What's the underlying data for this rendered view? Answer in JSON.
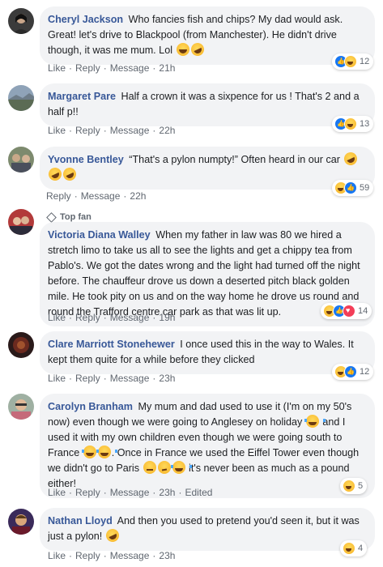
{
  "actions": {
    "like": "Like",
    "reply": "Reply",
    "message": "Message",
    "separator": "·",
    "edited": "Edited"
  },
  "comments": [
    {
      "author": "Cheryl Jackson",
      "text": "Who fancies fish and chips? My dad would ask. Great! let's drive to Blackpool (from Manchester). He didn't drive though, it was me mum. Lol",
      "time": "21h",
      "reaction_count": "12"
    },
    {
      "author": "Margaret Pare",
      "text": "Half a crown it was a sixpence for us ! That's 2 and a half p!!",
      "time": "22h",
      "reaction_count": "13"
    },
    {
      "author": "Yvonne Bentley",
      "text": "“That's a pylon numpty!” Often heard in our car",
      "time": "22h",
      "reaction_count": "59"
    },
    {
      "badge": "Top fan",
      "author": "Victoria Diana Walley",
      "text": "When my father in law was 80 we hired a stretch limo to take us all to see the lights and get a chippy tea from Pablo's. We got the dates wrong and the light had turned off the night before. The chauffeur drove us down a deserted pitch black golden mile. He took pity on us and on the way home he drove us round and round the Trafford centre car park as that was lit up.",
      "time": "19h",
      "reaction_count": "14"
    },
    {
      "author": "Clare Marriott Stonehewer",
      "text": "I once used this in the way to Wales. It kept them quite for a while before they clicked",
      "time": "23h",
      "reaction_count": "12"
    },
    {
      "author": "Carolyn Branham",
      "text_1": "My mum and dad used to use it (I'm on my 50's now) even though we were going to Anglesey on holiday",
      "text_2": "and I used it with my own children even though we were going south to France",
      "text_3": ". Once in France we used the Eiffel Tower even though we didn't go to Paris",
      "text_4": "it's never been as much as a pound either!",
      "time": "23h",
      "reaction_count": "5"
    },
    {
      "author": "Nathan Lloyd",
      "text": "And then you used to pretend you'd seen it, but it was just a pylon!",
      "time": "23h",
      "reaction_count": "4"
    }
  ],
  "colors": {
    "author": "#385898",
    "bubble": "#f2f3f5",
    "meta": "#606770"
  },
  "icons": [
    "laughing-emoji-icon",
    "rofl-emoji-icon",
    "tears-of-joy-emoji-icon",
    "eye-roll-emoji-icon",
    "thinking-emoji-icon",
    "haha-reaction-icon",
    "like-reaction-icon",
    "love-reaction-icon",
    "top-fan-diamond-icon"
  ]
}
